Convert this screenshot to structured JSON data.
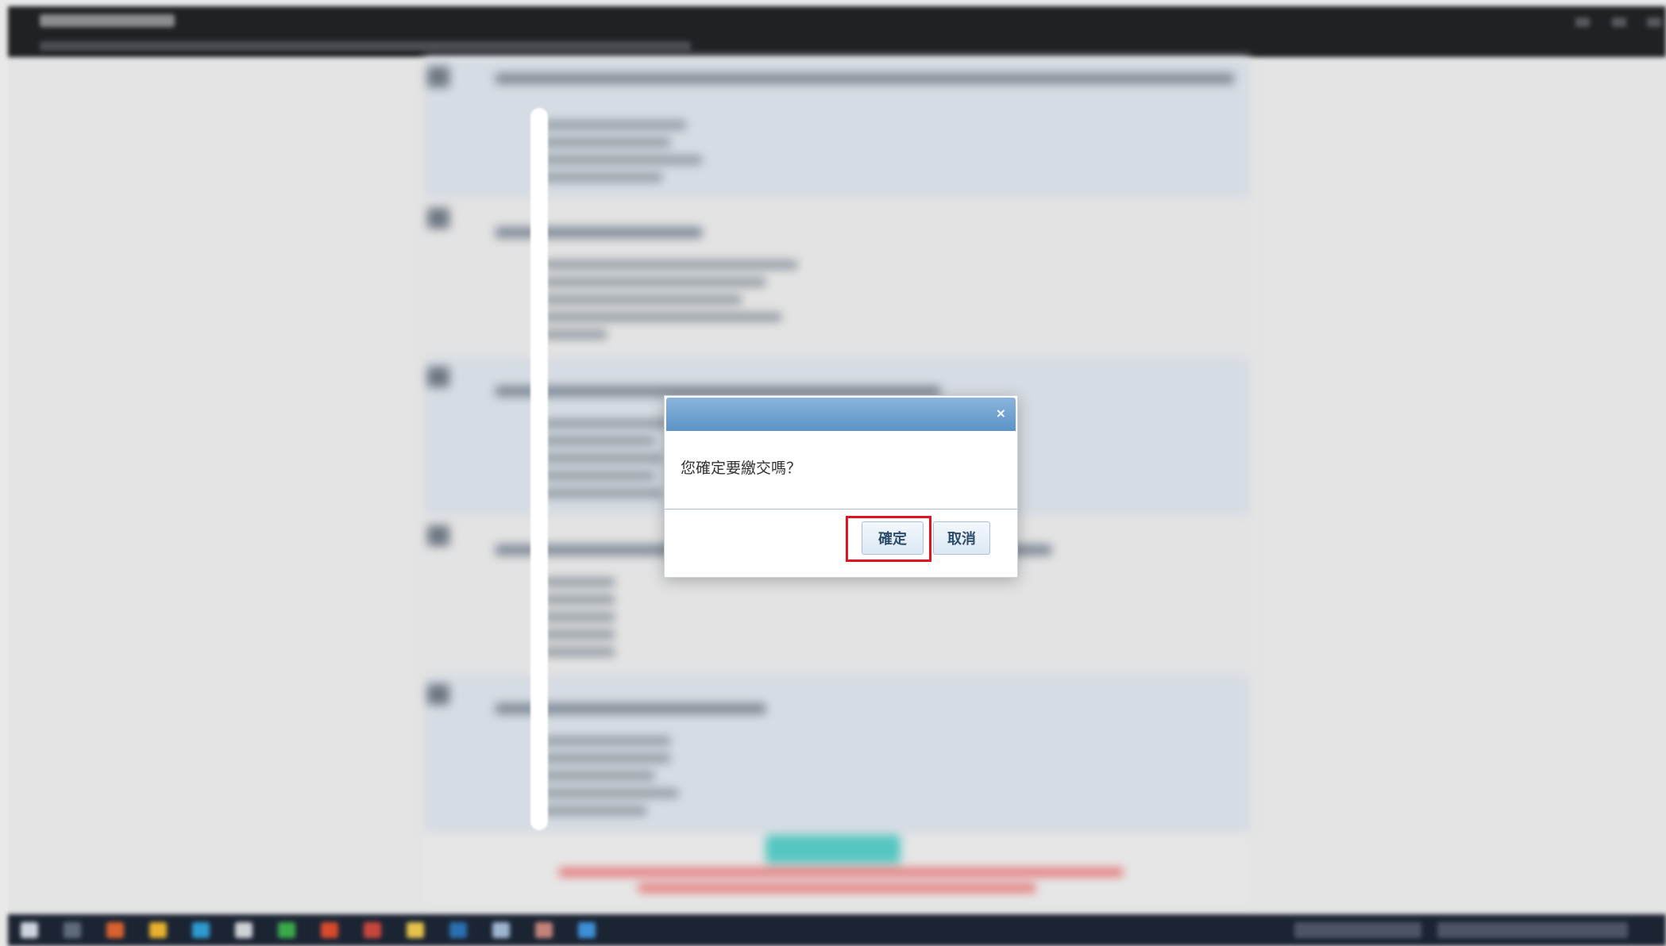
{
  "dialog": {
    "close_symbol": "×",
    "message": "您確定要繳交嗎？",
    "confirm_label": "確定",
    "cancel_label": "取消"
  },
  "colors": {
    "dialog_header": "#6fa3d3",
    "highlight_box": "#e4121b",
    "submit_button": "#54c6c1"
  },
  "icons": [
    "close-icon"
  ]
}
